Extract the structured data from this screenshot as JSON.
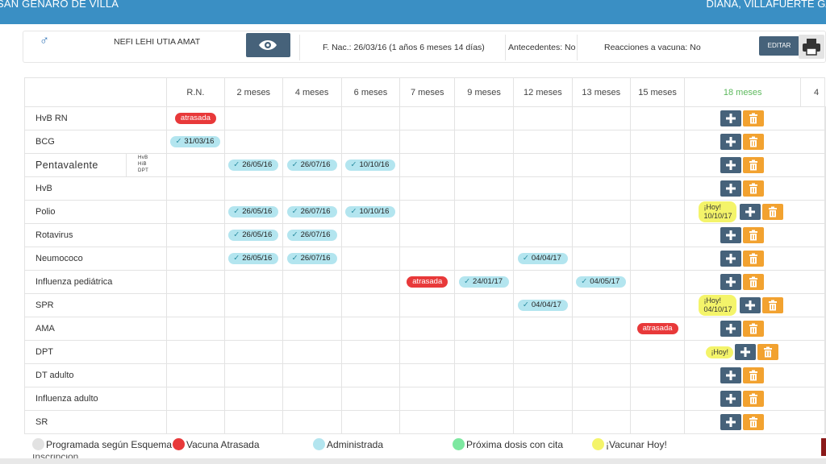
{
  "header": {
    "clinic": "SAN GENARO DE VILLA",
    "user": "DIANA, VILLAFUERTE GA"
  },
  "patient": {
    "gender_icon": "male-icon",
    "name": "NEFI LEHI UTIA AMAT",
    "birth": "F. Nac.: 26/03/16 (1 años 6 meses 14 días)",
    "antecedentes": "Antecedentes: No",
    "reacciones": "Reacciones a vacuna: No",
    "edit_label": "EDITAR",
    "print_icon": "printer-icon",
    "view_icon": "eye-icon"
  },
  "colors": {
    "header": "#3a8fc4",
    "add_button": "#46627a",
    "delete_button": "#f2a230",
    "late": "#e8393a",
    "administered": "#b3e5ef",
    "today": "#f4f46a",
    "next_dose": "#7de8a0",
    "scheduled": "#e2e2e2",
    "current_col": "#5cb85c"
  },
  "columns": [
    "R.N.",
    "2 meses",
    "4 meses",
    "6 meses",
    "7 meses",
    "9 meses",
    "12 meses",
    "13 meses",
    "15 meses",
    "18 meses",
    "4"
  ],
  "vaccines": [
    {
      "name": "HvB RN",
      "cells": {
        "0": {
          "type": "late",
          "text": "atrasada"
        }
      },
      "actions": "normal"
    },
    {
      "name": "BCG",
      "cells": {
        "0": {
          "type": "done",
          "text": "31/03/16"
        }
      },
      "actions": "normal"
    },
    {
      "name": "Pentavalente",
      "sub": [
        "HvB",
        "HiB",
        "DPT"
      ],
      "cells": {
        "1": {
          "type": "done",
          "text": "26/05/16"
        },
        "2": {
          "type": "done",
          "text": "26/07/16"
        },
        "3": {
          "type": "done",
          "text": "10/10/16"
        }
      },
      "actions": "normal"
    },
    {
      "name": "HvB",
      "cells": {},
      "actions": "normal"
    },
    {
      "name": "Polio",
      "cells": {
        "1": {
          "type": "done",
          "text": "26/05/16"
        },
        "2": {
          "type": "done",
          "text": "26/07/16"
        },
        "3": {
          "type": "done",
          "text": "10/10/16"
        }
      },
      "actions": "today",
      "today": [
        "¡Hoy!",
        "10/10/17"
      ],
      "edge": "1"
    },
    {
      "name": "Rotavirus",
      "cells": {
        "1": {
          "type": "done",
          "text": "26/05/16"
        },
        "2": {
          "type": "done",
          "text": "26/07/16"
        }
      },
      "actions": "normal"
    },
    {
      "name": "Neumococo",
      "cells": {
        "1": {
          "type": "done",
          "text": "26/05/16"
        },
        "2": {
          "type": "done",
          "text": "26/07/16"
        },
        "6": {
          "type": "done",
          "text": "04/04/17"
        }
      },
      "actions": "normal"
    },
    {
      "name": "Influenza pediátrica",
      "cells": {
        "4": {
          "type": "late",
          "text": "atrasada"
        },
        "5": {
          "type": "done",
          "text": "24/01/17"
        },
        "7": {
          "type": "done",
          "text": "04/05/17"
        }
      },
      "actions": "normal"
    },
    {
      "name": "SPR",
      "cells": {
        "6": {
          "type": "done",
          "text": "04/04/17"
        }
      },
      "actions": "today",
      "today": [
        "¡Hoy!",
        "04/10/17"
      ]
    },
    {
      "name": "AMA",
      "cells": {
        "8": {
          "type": "late",
          "text": "atrasada"
        }
      },
      "actions": "normal"
    },
    {
      "name": "DPT",
      "cells": {},
      "actions": "today",
      "today": [
        "¡Hoy!"
      ],
      "edge": "pro"
    },
    {
      "name": "DT adulto",
      "cells": {},
      "actions": "normal"
    },
    {
      "name": "Influenza adulto",
      "cells": {},
      "actions": "normal"
    },
    {
      "name": "SR",
      "cells": {},
      "actions": "normal"
    }
  ],
  "legend": [
    {
      "label": "Programada según Esquema",
      "color": "#e2e2e2"
    },
    {
      "label": "Vacuna Atrasada",
      "color": "#e8393a"
    },
    {
      "label": "Administrada",
      "color": "#b3e5ef"
    },
    {
      "label": "Próxima dosis con cita",
      "color": "#7de8a0"
    },
    {
      "label": "¡Vacunar Hoy!",
      "color": "#f4f46a"
    }
  ],
  "legend_cut": "Inscripción"
}
